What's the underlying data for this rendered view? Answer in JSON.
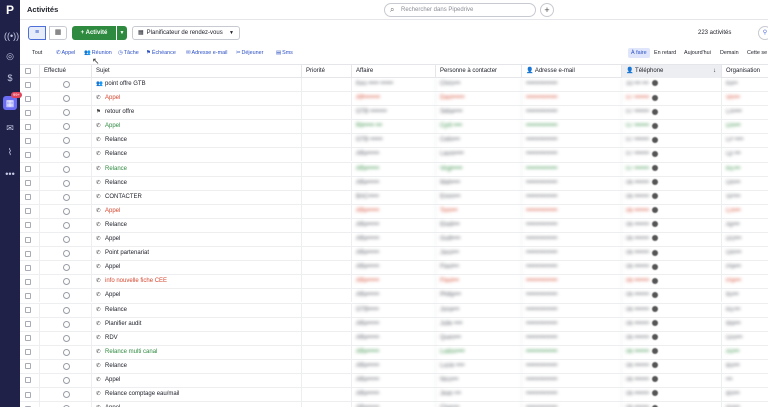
{
  "nav": {
    "logo": "P",
    "badge": "99+",
    "icons": [
      "radio-icon",
      "target-icon",
      "dollar-icon",
      "calendar-icon",
      "mail-icon",
      "chart-icon",
      "more-icon"
    ]
  },
  "header": {
    "title": "Activités",
    "search_placeholder": "Rechercher dans Pipedrive",
    "plus": "+"
  },
  "toolbar": {
    "add_label": "Activité",
    "add_plus": "+",
    "planner_label": "Planificateur de rendez-vous",
    "count": "223 activités"
  },
  "filters": {
    "all": "Tout",
    "types": [
      "Appel",
      "Réunion",
      "Tâche",
      "Échéance",
      "Adresse e-mail",
      "Déjeuner",
      "Sms"
    ],
    "periods": [
      "À faire",
      "En retard",
      "Aujourd'hui",
      "Demain",
      "Cette se"
    ]
  },
  "columns": [
    "Effectué",
    "Sujet",
    "Priorité",
    "Affaire",
    "Personne à contacter",
    "Adresse e-mail",
    "Téléphone",
    "Organisation"
  ],
  "rows": [
    {
      "icon": "people-icon",
      "subject": "point offre GTB",
      "color": "normal",
      "deal": "Keo ••••• ••••••",
      "person": "Chris•••",
      "email": "•••••••••••••••",
      "phone": "33 ••• •••",
      "org": "Ke••"
    },
    {
      "icon": "phone-icon",
      "subject": "Appel",
      "color": "red",
      "deal": "Aff••••••••",
      "person": "Davi••••••",
      "email": "•••••••••••••••",
      "phone": "07 •••••••",
      "org": "VA•••"
    },
    {
      "icon": "flag-icon",
      "subject": "retour offre",
      "color": "normal",
      "deal": "GTB ••••••••",
      "person": "Séba••••",
      "email": "•••••••••••••••",
      "phone": "07 •••••••",
      "org": "LA••••"
    },
    {
      "icon": "phone-icon",
      "subject": "Appel",
      "color": "green",
      "deal": "Ré••••• •••",
      "person": "Cyril ••••",
      "email": "•••••••••••••••",
      "phone": "07 •••••••",
      "org": "DA•••"
    },
    {
      "icon": "phone-icon",
      "subject": "Relance",
      "color": "normal",
      "deal": "GTB ••••••",
      "person": "Celin•••",
      "email": "•••••••••••••••",
      "phone": "07 •••••••",
      "org": "LP ••••"
    },
    {
      "icon": "phone-icon",
      "subject": "Relance",
      "color": "normal",
      "deal": "Affa••••••",
      "person": "Laure••••",
      "email": "•••••••••••••••",
      "phone": "07 •••••••",
      "org": "Lp •••"
    },
    {
      "icon": "phone-icon",
      "subject": "Relance",
      "color": "green",
      "deal": "Affa••••••",
      "person": "Virgi•••••",
      "email": "•••••••••••••••",
      "phone": "07 •••••••",
      "org": "KE•••"
    },
    {
      "icon": "phone-icon",
      "subject": "Relance",
      "color": "normal",
      "deal": "Affa••••••",
      "person": "Mah••••",
      "email": "•••••••••••••••",
      "phone": "06 •••••••",
      "org": "Ori•••"
    },
    {
      "icon": "phone-icon",
      "subject": "CONTACTER",
      "color": "normal",
      "deal": "BAC•••••",
      "person": "Emm•••",
      "email": "•••••••••••••••",
      "phone": "06 •••••••",
      "org": "SP•••"
    },
    {
      "icon": "phone-icon",
      "subject": "Appel",
      "color": "red",
      "deal": "Affa••••••",
      "person": "Tom•••",
      "email": "•••••••••••••••",
      "phone": "06 •••••••",
      "org": "CA•••"
    },
    {
      "icon": "phone-icon",
      "subject": "Relance",
      "color": "normal",
      "deal": "Affa••••••",
      "person": "Elodi•••",
      "email": "•••••••••••••••",
      "phone": "06 •••••••",
      "org": "Ap•••"
    },
    {
      "icon": "phone-icon",
      "subject": "Appel",
      "color": "normal",
      "deal": "Affa••••••",
      "person": "Guill••••",
      "email": "•••••••••••••••",
      "phone": "06 •••••••",
      "org": "DO•••"
    },
    {
      "icon": "phone-icon",
      "subject": "Point partenariat",
      "color": "normal",
      "deal": "Affa••••••",
      "person": "Jaso•••",
      "email": "•••••••••••••••",
      "phone": "06 •••••••",
      "org": "GR•••"
    },
    {
      "icon": "phone-icon",
      "subject": "Appel",
      "color": "normal",
      "deal": "Affa••••••",
      "person": "Flavi•••",
      "email": "•••••••••••••••",
      "phone": "06 •••••••",
      "org": "Pla•••"
    },
    {
      "icon": "phone-icon",
      "subject": "info nouvelle fiche CEE",
      "color": "red",
      "deal": "Affa••••••",
      "person": "Flavi•••",
      "email": "•••••••••••••••",
      "phone": "06 •••••••",
      "org": "Pla•••"
    },
    {
      "icon": "phone-icon",
      "subject": "Appel",
      "color": "normal",
      "deal": "Affa••••••",
      "person": "Philip•••",
      "email": "•••••••••••••••",
      "phone": "06 •••••••",
      "org": "flu•••"
    },
    {
      "icon": "phone-icon",
      "subject": "Relance",
      "color": "normal",
      "deal": "GTB•••••",
      "person": "Jona•••",
      "email": "•••••••••••••••",
      "phone": "06 •••••••",
      "org": "KE•••"
    },
    {
      "icon": "phone-icon",
      "subject": "Planifier audit",
      "color": "normal",
      "deal": "Affa••••••",
      "person": "Julie ••••",
      "email": "•••••••••••••••",
      "phone": "06 •••••••",
      "org": "Ma•••"
    },
    {
      "icon": "phone-icon",
      "subject": "RDV",
      "color": "normal",
      "deal": "Affa••••••",
      "person": "Quen•••",
      "email": "•••••••••••••••",
      "phone": "06 •••••••",
      "org": "Gro•••"
    },
    {
      "icon": "phone-icon",
      "subject": "Relance multi canal",
      "color": "green",
      "deal": "Affa••••••",
      "person": "Ludov••••",
      "email": "•••••••••••••••",
      "phone": "06 •••••••",
      "org": "As•••"
    },
    {
      "icon": "phone-icon",
      "subject": "Relance",
      "color": "normal",
      "deal": "Affa••••••",
      "person": "Lucie ••••",
      "email": "•••••••••••••••",
      "phone": "06 •••••••",
      "org": "Bu•••"
    },
    {
      "icon": "phone-icon",
      "subject": "Appel",
      "color": "normal",
      "deal": "Affa••••••",
      "person": "Nico•••",
      "email": "•••••••••••••••",
      "phone": "06 •••••••",
      "org": "•••"
    },
    {
      "icon": "phone-icon",
      "subject": "Relance comptage eau/mail",
      "color": "normal",
      "deal": "Affa••••••",
      "person": "Jean •••",
      "email": "•••••••••••••••",
      "phone": "06 •••••••",
      "org": "Bri•••"
    },
    {
      "icon": "phone-icon",
      "subject": "Appel",
      "color": "normal",
      "deal": "Affa••••••",
      "person": "Char•••",
      "email": "•••••••••••••••",
      "phone": "06 •••••••",
      "org": "Ro•••"
    }
  ],
  "colors": {
    "accent": "#2b4fc4",
    "add_button": "#2d8a3e",
    "nav_bg": "#1f2148",
    "overdue": "#d4472f",
    "today": "#2f8a3f"
  }
}
